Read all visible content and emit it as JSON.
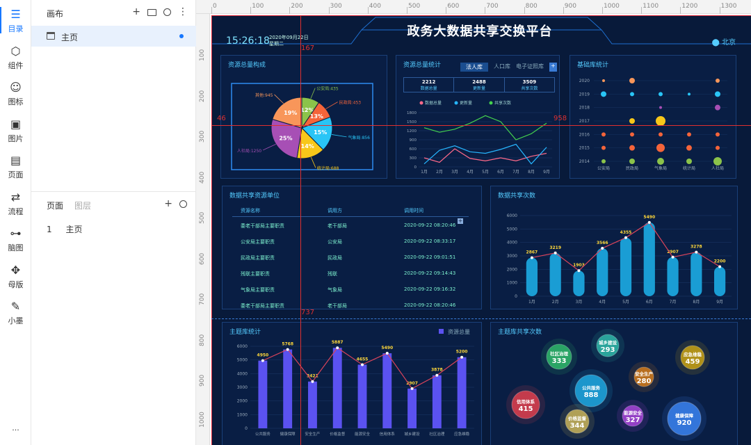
{
  "rail": [
    {
      "label": "目录",
      "icon": "catalog-icon",
      "active": true
    },
    {
      "label": "组件",
      "icon": "component-icon"
    },
    {
      "label": "图标",
      "icon": "emoji-icon"
    },
    {
      "label": "图片",
      "icon": "image-icon"
    },
    {
      "label": "页面",
      "icon": "page-icon"
    },
    {
      "label": "流程",
      "icon": "flow-icon"
    },
    {
      "label": "脑图",
      "icon": "mindmap-icon"
    },
    {
      "label": "母版",
      "icon": "master-icon"
    },
    {
      "label": "小墨",
      "icon": "magic-wand-icon"
    }
  ],
  "rail_more": "···",
  "panel": {
    "canvas_title": "画布",
    "canvas_item": "主页",
    "tabs": [
      "页面",
      "图层"
    ],
    "page_index": "1",
    "page_name": "主页"
  },
  "ruler": {
    "top": [
      "0",
      "100",
      "200",
      "300",
      "400",
      "500",
      "600",
      "700",
      "800",
      "900",
      "1000",
      "1100",
      "1200",
      "1300"
    ],
    "left": [
      "100",
      "200",
      "300",
      "400",
      "500",
      "600",
      "700",
      "800",
      "900",
      "1000"
    ]
  },
  "guides": {
    "top": "167",
    "left": "46",
    "right": "958",
    "bottom": "737"
  },
  "dashboard": {
    "title": "政务大数据共享交换平台",
    "time": "15:26:18",
    "date": "2020年09月22日",
    "weekday": "星期二",
    "city": "北京",
    "p1_title": "资源总量构成",
    "p2_title": "资源总量统计",
    "p2_tabs": [
      "法人库",
      "人口库",
      "电子证照库"
    ],
    "p2_stats": [
      {
        "v": "2212",
        "l": "数据总量"
      },
      {
        "v": "2488",
        "l": "更新量"
      },
      {
        "v": "3509",
        "l": "共享次数"
      }
    ],
    "p2_legend": [
      "数据总量",
      "更新量",
      "共享次数"
    ],
    "p3_title": "基础库统计",
    "p4_title": "数据共享资源单位",
    "p4_headers": [
      "资源名称",
      "调用方",
      "调用时间"
    ],
    "p4_rows": [
      [
        "委老干部局主要职责",
        "老干部局",
        "2020-09-22 08:20:46"
      ],
      [
        "公安局主要职责",
        "公安局",
        "2020-09-22 08:33:17"
      ],
      [
        "民政局主要职责",
        "民政局",
        "2020-09-22 09:01:51"
      ],
      [
        "残联主要职责",
        "残联",
        "2020-09-22 09:14:43"
      ],
      [
        "气象局主要职责",
        "气象局",
        "2020-09-22 09:16:32"
      ],
      [
        "委老干部局主要职责",
        "老干部局",
        "2020-09-22 08:20:46"
      ]
    ],
    "p5_title": "数据共享次数",
    "p6_title": "主题库统计",
    "p6_legend": "资源总量",
    "p7_title": "主题库共享次数",
    "bubbles": [
      {
        "name": "社区治理",
        "v": "333",
        "c": "#2fb86a"
      },
      {
        "name": "城乡建设",
        "v": "293",
        "c": "#2fb8a8"
      },
      {
        "name": "应急维稳",
        "v": "459",
        "c": "#c9a213"
      },
      {
        "name": "安全生产",
        "v": "280",
        "c": "#d27a1a"
      },
      {
        "name": "公共服务",
        "v": "888",
        "c": "#1fa8e0"
      },
      {
        "name": "信用体系",
        "v": "415",
        "c": "#e0404e"
      },
      {
        "name": "价格监督",
        "v": "344",
        "c": "#c9b35a"
      },
      {
        "name": "能源安全",
        "v": "327",
        "c": "#a846d8"
      },
      {
        "name": "健康保障",
        "v": "920",
        "c": "#3a82f0"
      }
    ]
  },
  "chart_data": [
    {
      "type": "pie",
      "title": "资源总量构成",
      "categories": [
        "公安局",
        "民政局",
        "气象局",
        "统计局",
        "人社局",
        "其他"
      ],
      "values": [
        435,
        453,
        856,
        688,
        1250,
        945
      ],
      "labels": [
        "公安局:435",
        "民政局:453",
        "气象局:856",
        "统计局:688",
        "人社局:1250",
        "其他:945"
      ],
      "percent_labels": [
        "12%",
        "13%",
        "15%",
        "14%",
        "25%",
        "19%"
      ],
      "colors": [
        "#8bc34a",
        "#f4643a",
        "#29c5f6",
        "#f7c71a",
        "#a74fb5",
        "#f8965a"
      ]
    },
    {
      "type": "line",
      "title": "资源总量统计",
      "x": [
        "1月",
        "2月",
        "3月",
        "4月",
        "5月",
        "6月",
        "7月",
        "8月",
        "9月"
      ],
      "ylim": [
        0,
        1800
      ],
      "yticks": [
        0,
        300,
        600,
        900,
        1200,
        1500,
        1800
      ],
      "series": [
        {
          "name": "数据总量",
          "color": "#ff6a8a",
          "values": [
            300,
            150,
            600,
            280,
            200,
            300,
            200,
            350,
            450
          ]
        },
        {
          "name": "更新量",
          "color": "#27b6ff",
          "values": [
            100,
            550,
            700,
            500,
            450,
            580,
            750,
            100,
            650
          ]
        },
        {
          "name": "共享次数",
          "color": "#44d24e",
          "values": [
            1300,
            1150,
            1250,
            1450,
            1700,
            1500,
            900,
            1100,
            1450
          ]
        }
      ]
    },
    {
      "type": "scatter",
      "title": "基础库统计",
      "x": [
        "公安局",
        "民政局",
        "气象局",
        "统计局",
        "人社局"
      ],
      "y": [
        "2014",
        "2015",
        "2016",
        "2017",
        "2018",
        "2019",
        "2020"
      ],
      "points": [
        [
          "公安局",
          "2014",
          3,
          "#8bc34a"
        ],
        [
          "民政局",
          "2014",
          4,
          "#8bc34a"
        ],
        [
          "气象局",
          "2014",
          5,
          "#8bc34a"
        ],
        [
          "统计局",
          "2014",
          4,
          "#8bc34a"
        ],
        [
          "人社局",
          "2014",
          6,
          "#8bc34a"
        ],
        [
          "公安局",
          "2015",
          3,
          "#f4643a"
        ],
        [
          "民政局",
          "2015",
          4,
          "#f4643a"
        ],
        [
          "气象局",
          "2015",
          6,
          "#f4643a"
        ],
        [
          "统计局",
          "2015",
          4,
          "#f4643a"
        ],
        [
          "人社局",
          "2015",
          3,
          "#f4643a"
        ],
        [
          "公安局",
          "2016",
          3,
          "#f4643a"
        ],
        [
          "民政局",
          "2016",
          3,
          "#f4643a"
        ],
        [
          "气象局",
          "2016",
          3,
          "#f4643a"
        ],
        [
          "统计局",
          "2016",
          3,
          "#f4643a"
        ],
        [
          "人社局",
          "2016",
          3,
          "#f4643a"
        ],
        [
          "民政局",
          "2017",
          4,
          "#f7c71a"
        ],
        [
          "气象局",
          "2017",
          7,
          "#f7c71a"
        ],
        [
          "气象局",
          "2018",
          2,
          "#a74fb5"
        ],
        [
          "人社局",
          "2018",
          4,
          "#a74fb5"
        ],
        [
          "公安局",
          "2019",
          4,
          "#29c5f6"
        ],
        [
          "民政局",
          "2019",
          3,
          "#29c5f6"
        ],
        [
          "气象局",
          "2019",
          3,
          "#29c5f6"
        ],
        [
          "统计局",
          "2019",
          2,
          "#29c5f6"
        ],
        [
          "人社局",
          "2019",
          4,
          "#29c5f6"
        ],
        [
          "公安局",
          "2020",
          2,
          "#f8965a"
        ],
        [
          "民政局",
          "2020",
          4,
          "#f8965a"
        ],
        [
          "人社局",
          "2020",
          3,
          "#f8965a"
        ]
      ]
    },
    {
      "type": "bar",
      "title": "数据共享次数",
      "categories": [
        "1月",
        "2月",
        "3月",
        "4月",
        "5月",
        "6月",
        "7月",
        "8月",
        "9月"
      ],
      "values": [
        2867,
        3219,
        1903,
        3566,
        4355,
        5490,
        2907,
        3278,
        2200
      ],
      "ylim": [
        0,
        6000
      ],
      "yticks": [
        0,
        1000,
        2000,
        3000,
        4000,
        5000,
        6000
      ]
    },
    {
      "type": "bar",
      "title": "主题库统计",
      "categories": [
        "公共服务",
        "健康保障",
        "安全生产",
        "价格监督",
        "能源安全",
        "信用体系",
        "城乡建设",
        "社区治理",
        "应急维稳"
      ],
      "values": [
        4950,
        5768,
        3421,
        5887,
        4655,
        5490,
        2907,
        3878,
        5200
      ],
      "series": [
        {
          "name": "资源总量"
        }
      ],
      "ylim": [
        0,
        6000
      ],
      "yticks": [
        0,
        1000,
        2000,
        3000,
        4000,
        5000,
        6000
      ]
    }
  ]
}
